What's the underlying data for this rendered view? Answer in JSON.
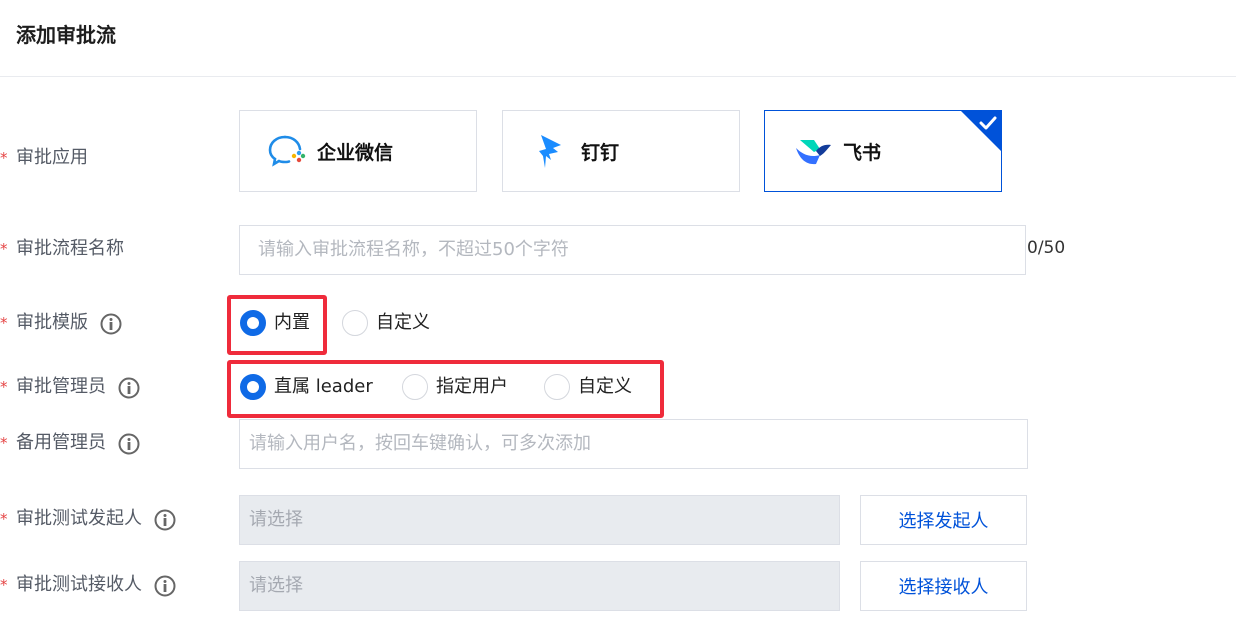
{
  "header": {
    "title": "添加审批流"
  },
  "labels": {
    "approval_app": "审批应用",
    "flow_name": "审批流程名称",
    "template": "审批模版",
    "admin": "审批管理员",
    "backup_admin": "备用管理员",
    "test_initiator": "审批测试发起人",
    "test_receiver": "审批测试接收人"
  },
  "required_mark": "*",
  "apps": [
    {
      "name": "企业微信",
      "icon": "wecom-icon",
      "selected": false
    },
    {
      "name": "钉钉",
      "icon": "dingtalk-icon",
      "selected": false
    },
    {
      "name": "飞书",
      "icon": "feishu-icon",
      "selected": true
    }
  ],
  "flow_name": {
    "placeholder": "请输入审批流程名称，不超过50个字符",
    "value": "",
    "counter": "0/50"
  },
  "template": {
    "options": [
      {
        "label": "内置",
        "checked": true
      },
      {
        "label": "自定义",
        "checked": false
      }
    ]
  },
  "admin": {
    "options": [
      {
        "label": "直属 leader",
        "checked": true
      },
      {
        "label": "指定用户",
        "checked": false
      },
      {
        "label": "自定义",
        "checked": false
      }
    ]
  },
  "backup_admin": {
    "placeholder": "请输入用户名，按回车键确认，可多次添加"
  },
  "test_initiator": {
    "placeholder": "请选择",
    "button": "选择发起人"
  },
  "test_receiver": {
    "placeholder": "请选择",
    "button": "选择接收人"
  },
  "colors": {
    "accent": "#0052d9",
    "radio_on": "#0f6ae6",
    "highlight": "#ef2b3b",
    "required": "#e54545"
  }
}
